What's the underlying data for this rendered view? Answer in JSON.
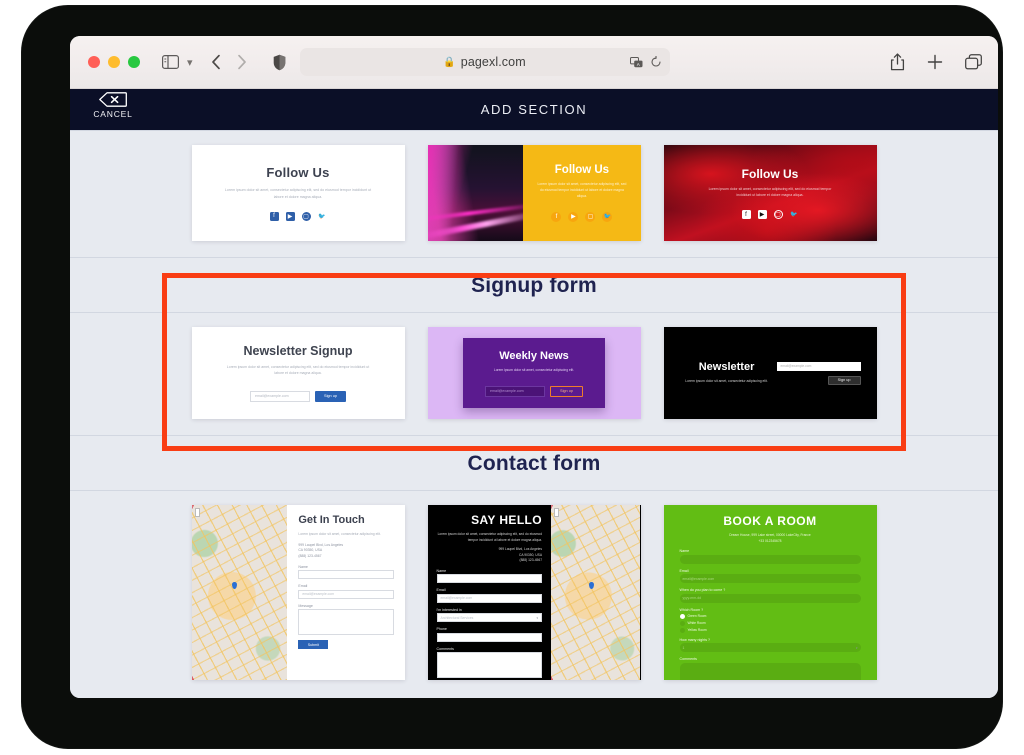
{
  "browser": {
    "url": "pagexl.com",
    "lock_icon": "lock-icon",
    "sidebar_icon": "sidebar-icon",
    "chevron_icon": "chevron-down-icon",
    "back_icon": "back-chevron-icon",
    "forward_icon": "forward-chevron-icon",
    "shield_icon": "shield-icon",
    "translate_icon": "translate-icon",
    "reload_icon": "reload-icon",
    "share_icon": "share-icon",
    "newtab_icon": "plus-icon",
    "tabs_icon": "tab-overview-icon"
  },
  "app": {
    "cancel_label": "CANCEL",
    "cancel_icon": "close-tag-icon",
    "title": "ADD SECTION"
  },
  "sections": [
    {
      "id": "follow-us",
      "title": "",
      "cards": [
        {
          "id": "follow-us-white",
          "heading": "Follow Us",
          "description": "Lorem ipsum dolor sit amet, consectetur adipiscing elit, sed do eiusmod tempor incididunt ut labore et dolore magna aliqua.",
          "socials": [
            "facebook-icon",
            "youtube-icon",
            "instagram-icon",
            "twitter-icon"
          ]
        },
        {
          "id": "follow-us-yellow",
          "heading": "Follow Us",
          "description": "Lorem ipsum dolor sit amet, consectetur adipiscing elit, sed do eiusmod tempor incididunt ut labore et dolore magna aliqua.",
          "socials": [
            "facebook-icon",
            "youtube-icon",
            "instagram-icon",
            "twitter-icon"
          ],
          "accent": "#f5b915"
        },
        {
          "id": "follow-us-red",
          "heading": "Follow Us",
          "description": "Lorem ipsum dolor sit amet, consectetur adipiscing elit, sed do eiusmod tempor incididunt ut labore et dolore magna aliqua.",
          "socials": [
            "facebook-icon",
            "youtube-icon",
            "instagram-icon",
            "twitter-icon"
          ],
          "accent": "#c01020"
        }
      ]
    },
    {
      "id": "signup-form",
      "title": "Signup form",
      "highlighted": true,
      "cards": [
        {
          "id": "newsletter-signup-white",
          "heading": "Newsletter Signup",
          "description": "Lorem ipsum dolor sit amet, consectetur adipiscing elit, sed do eiusmod tempor incididunt ut labore et dolore magna aliqua.",
          "email_placeholder": "email@example.com",
          "button_label": "Sign up",
          "accent": "#2a62b5"
        },
        {
          "id": "weekly-news-purple",
          "heading": "Weekly News",
          "description": "Lorem ipsum dolor sit amet, consectetur adipiscing elit.",
          "email_placeholder": "email@example.com",
          "button_label": "Sign up",
          "accent": "#5b1b8f"
        },
        {
          "id": "newsletter-black",
          "heading": "Newsletter",
          "description": "Lorem ipsum dolor sit amet, consectetur adipiscing elit.",
          "email_placeholder": "email@example.com",
          "button_label": "Sign up",
          "accent": "#000000"
        }
      ]
    },
    {
      "id": "contact-form",
      "title": "Contact form",
      "cards": [
        {
          "id": "get-in-touch",
          "heading": "Get In Touch",
          "description": "Lorem ipsum dolor sit amet, consectetur adipiscing elit.",
          "address": "999 Laupel Blvd, Los Angeles\nCA 90350, USA\n(888) 123-4567",
          "fields": [
            {
              "label": "Name",
              "placeholder": "",
              "type": "text"
            },
            {
              "label": "Email",
              "placeholder": "email@example.com",
              "type": "text"
            },
            {
              "label": "Message",
              "placeholder": "",
              "type": "textarea"
            }
          ],
          "button_label": "Submit",
          "accent": "#2a62b5",
          "has_map": true
        },
        {
          "id": "say-hello",
          "heading": "SAY HELLO",
          "description": "Lorem ipsum dolor sit amet, consectetur adipiscing elit, sed do eiusmod tempor incididunt ut labore et dolore magna aliqua.",
          "address": "999 Laupel Blvd, Los Angeles\nCA 90350, USA\n(888) 123-4567",
          "fields": [
            {
              "label": "Name",
              "placeholder": "",
              "type": "text"
            },
            {
              "label": "Email",
              "placeholder": "email@example.com",
              "type": "text"
            },
            {
              "label": "I'm interested in",
              "placeholder": "Architectural Services",
              "type": "select"
            },
            {
              "label": "Phone",
              "placeholder": "",
              "type": "text"
            },
            {
              "label": "Comments",
              "placeholder": "",
              "type": "textarea"
            }
          ],
          "accent": "#000000",
          "has_map": true
        },
        {
          "id": "book-a-room",
          "heading": "BOOK A ROOM",
          "address": "Dream House, 999 Lake street, 00000 LakeCity, France\n+33 012345678",
          "fields": [
            {
              "label": "Name",
              "placeholder": "",
              "type": "text"
            },
            {
              "label": "Email",
              "placeholder": "email@example.com",
              "type": "text"
            },
            {
              "label": "When do you plan to come ?",
              "placeholder": "yyyy-mm-dd",
              "type": "text"
            },
            {
              "label": "Which Room ?",
              "type": "radio",
              "options": [
                "Green Room",
                "White Room",
                "Yellow Room"
              ],
              "selected": "Green Room"
            },
            {
              "label": "How many nights ?",
              "placeholder": "1",
              "type": "select"
            },
            {
              "label": "Comments",
              "placeholder": "",
              "type": "textarea"
            }
          ],
          "accent": "#62bd14"
        }
      ]
    }
  ]
}
